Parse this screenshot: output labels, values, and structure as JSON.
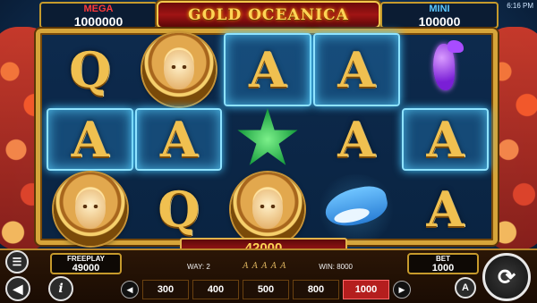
{
  "header": {
    "title": "GOLD OCEANICA",
    "clock": "6:16 PM"
  },
  "jackpots": {
    "mega": {
      "label": "MEGA",
      "value": "1000000"
    },
    "mini": {
      "label": "MINI",
      "value": "100000"
    }
  },
  "reels": {
    "grid": [
      [
        "Q",
        "medallion",
        "A",
        "A",
        "seahorse"
      ],
      [
        "A",
        "A",
        "starfish",
        "A",
        "A"
      ],
      [
        "medallion",
        "Q",
        "medallion",
        "dolphin",
        "A"
      ]
    ],
    "highlighted": [
      [
        false,
        false,
        true,
        true,
        false
      ],
      [
        true,
        true,
        false,
        false,
        true
      ],
      [
        false,
        false,
        false,
        false,
        false
      ]
    ]
  },
  "win": {
    "amount": "42000",
    "way_label": "WAY: 2",
    "way_symbols": [
      "A",
      "A",
      "A",
      "A",
      "A"
    ],
    "win_label": "WIN: 8000"
  },
  "freeplay": {
    "label": "FREEPLAY",
    "value": "49000"
  },
  "bet": {
    "label": "BET",
    "value": "1000",
    "options": [
      "300",
      "400",
      "500",
      "800",
      "1000"
    ],
    "selected": "1000"
  },
  "controls": {
    "menu_icon": "hamburger-icon",
    "sound_icon": "speaker-icon",
    "info_icon": "info-icon",
    "prev_icon": "chevron-left-icon",
    "next_icon": "chevron-right-icon",
    "auto_icon": "autoplay-icon",
    "spin_icon": "spin-icon"
  },
  "colors": {
    "frame_gold": "#d6a53a",
    "title_red": "#a01414",
    "highlight_cyan": "#8fe3ff",
    "selected_bet": "#b41e1e"
  }
}
